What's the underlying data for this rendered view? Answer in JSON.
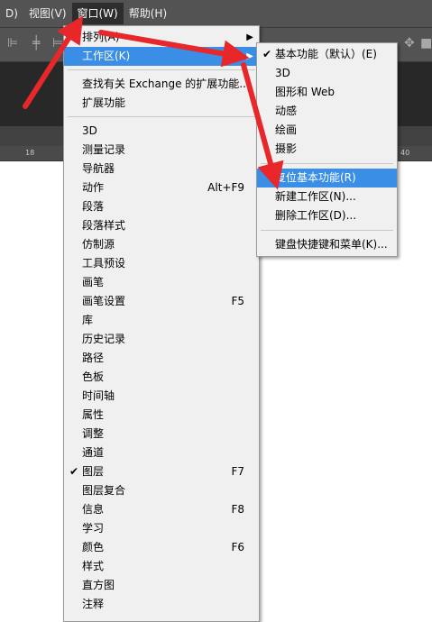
{
  "menubar": {
    "items": [
      {
        "label": "D)",
        "active": false
      },
      {
        "label": "视图(V)",
        "active": false
      },
      {
        "label": "窗口(W)",
        "active": true
      },
      {
        "label": "帮助(H)",
        "active": false
      }
    ]
  },
  "ruler": {
    "ticks": [
      "18",
      "40"
    ]
  },
  "window_menu": {
    "items": [
      {
        "label": "排列(A)",
        "submenu": true
      },
      {
        "label": "工作区(K)",
        "submenu": true,
        "highlighted": true
      },
      {
        "label": "查找有关 Exchange 的扩展功能..."
      },
      {
        "label": "扩展功能"
      },
      {
        "label": "3D"
      },
      {
        "label": "测量记录"
      },
      {
        "label": "导航器"
      },
      {
        "label": "动作",
        "shortcut": "Alt+F9"
      },
      {
        "label": "段落"
      },
      {
        "label": "段落样式"
      },
      {
        "label": "仿制源"
      },
      {
        "label": "工具预设"
      },
      {
        "label": "画笔"
      },
      {
        "label": "画笔设置",
        "shortcut": "F5"
      },
      {
        "label": "库"
      },
      {
        "label": "历史记录"
      },
      {
        "label": "路径"
      },
      {
        "label": "色板"
      },
      {
        "label": "时间轴"
      },
      {
        "label": "属性"
      },
      {
        "label": "调整"
      },
      {
        "label": "通道"
      },
      {
        "label": "图层",
        "shortcut": "F7",
        "checked": true
      },
      {
        "label": "图层复合"
      },
      {
        "label": "信息",
        "shortcut": "F8"
      },
      {
        "label": "学习"
      },
      {
        "label": "颜色",
        "shortcut": "F6"
      },
      {
        "label": "样式"
      },
      {
        "label": "直方图"
      },
      {
        "label": "注释"
      }
    ]
  },
  "workspace_submenu": {
    "items": [
      {
        "label": "基本功能（默认）(E)",
        "checked": true
      },
      {
        "label": "3D"
      },
      {
        "label": "图形和 Web"
      },
      {
        "label": "动感"
      },
      {
        "label": "绘画"
      },
      {
        "label": "摄影"
      },
      {
        "label": "复位基本功能(R)",
        "highlighted": true
      },
      {
        "label": "新建工作区(N)..."
      },
      {
        "label": "删除工作区(D)..."
      },
      {
        "label": "键盘快捷键和菜单(K)..."
      }
    ]
  },
  "glyphs": {
    "check": "✔",
    "arrow": "▶"
  },
  "colors": {
    "highlight": "#3a8ee6",
    "annotation_arrow": "#e8272a",
    "menu_bg": "#f0f0f0"
  }
}
